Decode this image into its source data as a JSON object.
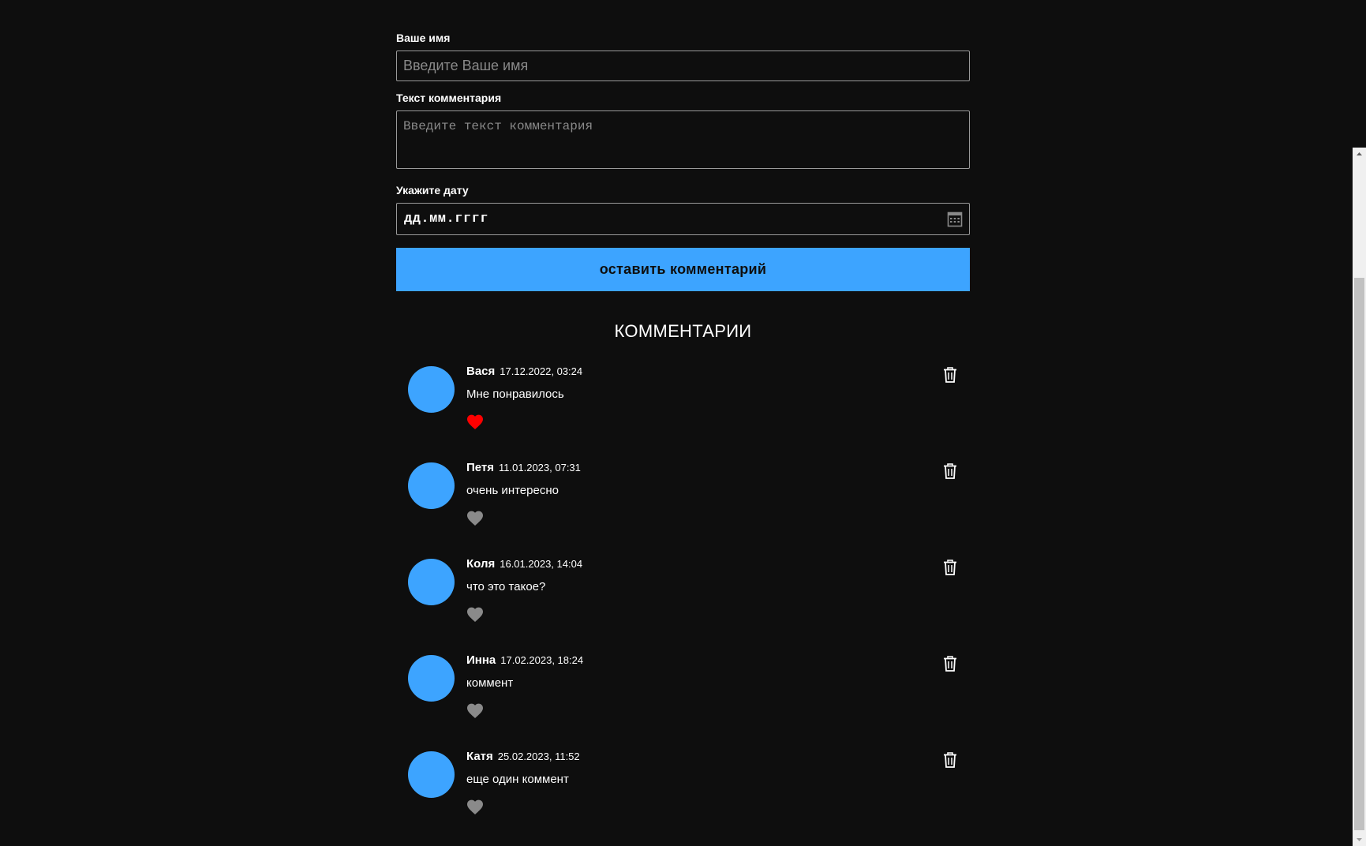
{
  "form": {
    "name_label": "Ваше имя",
    "name_placeholder": "Введите Ваше имя",
    "comment_label": "Текст комментария",
    "comment_placeholder": "Введите текст комментария",
    "date_label": "Укажите дату",
    "date_placeholder": "дд.мм.гггг",
    "date_icon": "calendar-icon",
    "submit_label": "оставить комментарий"
  },
  "comments_title": "КОММЕНТАРИИ",
  "comments": [
    {
      "name": "Вася",
      "date": "17.12.2022, 03:24",
      "text": "Мне понравилось",
      "liked": true
    },
    {
      "name": "Петя",
      "date": "11.01.2023, 07:31",
      "text": "очень интересно",
      "liked": false
    },
    {
      "name": "Коля",
      "date": "16.01.2023, 14:04",
      "text": "что это такое?",
      "liked": false
    },
    {
      "name": "Инна",
      "date": "17.02.2023, 18:24",
      "text": "коммент",
      "liked": false
    },
    {
      "name": "Катя",
      "date": "25.02.2023, 11:52",
      "text": "еще один коммент",
      "liked": false
    }
  ],
  "icons": {
    "like": "heart-icon",
    "delete": "trash-icon",
    "scroll_up": "scroll-up-arrow-icon",
    "scroll_down": "scroll-down-arrow-icon"
  },
  "colors": {
    "background": "#0e0e0e",
    "accent": "#3da4ff",
    "liked": "#ff0000",
    "unliked": "#8a8a8a"
  }
}
